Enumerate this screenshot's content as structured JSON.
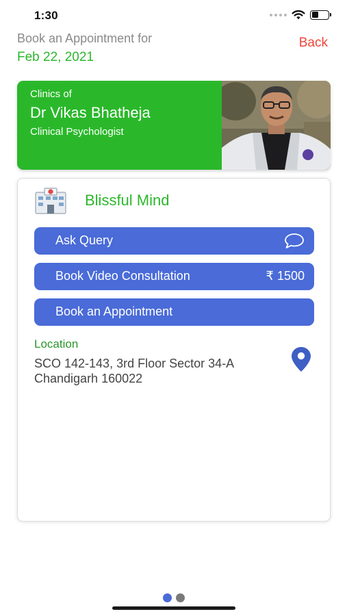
{
  "status_bar": {
    "time": "1:30",
    "icons": [
      "cellular-dots-icon",
      "wifi-icon",
      "battery-icon"
    ],
    "battery_level": 0.4
  },
  "header": {
    "label": "Book an Appointment for",
    "date": "Feb 22, 2021",
    "back_label": "Back"
  },
  "doctor": {
    "clinics_of": "Clinics of",
    "name": "Dr Vikas Bhatheja",
    "title": "Clinical Psychologist"
  },
  "clinic": {
    "icon": "hospital-icon",
    "name": "Blissful Mind",
    "buttons": {
      "ask_query": "Ask Query",
      "video_consultation": "Book Video Consultation",
      "video_price": "₹ 1500",
      "book_appointment": "Book an Appointment"
    },
    "location_label": "Location",
    "address_line1": "SCO 142-143, 3rd Floor Sector 34-A",
    "address_line2": "Chandigarh 160022"
  },
  "pager": {
    "total": 2,
    "current": 1
  },
  "colors": {
    "brand_green": "#2ab82a",
    "button_blue": "#4a6bd8",
    "back_red": "#f0453a",
    "header_gray": "#8a8a8a"
  }
}
